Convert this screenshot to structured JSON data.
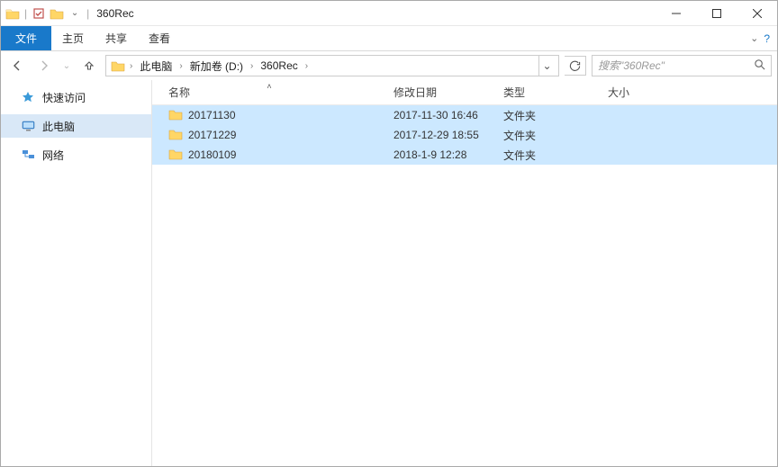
{
  "titlebar": {
    "title": "360Rec"
  },
  "ribbon": {
    "file": "文件",
    "home": "主页",
    "share": "共享",
    "view": "查看"
  },
  "breadcrumb": {
    "items": [
      {
        "label": "此电脑"
      },
      {
        "label": "新加卷 (D:)"
      },
      {
        "label": "360Rec"
      }
    ]
  },
  "search": {
    "placeholder": "搜索\"360Rec\""
  },
  "sidebar": {
    "quick": "快速访问",
    "thispc": "此电脑",
    "network": "网络"
  },
  "columns": {
    "name": "名称",
    "date": "修改日期",
    "type": "类型",
    "size": "大小"
  },
  "rows": [
    {
      "name": "20171130",
      "date": "2017-11-30 16:46",
      "type": "文件夹"
    },
    {
      "name": "20171229",
      "date": "2017-12-29 18:55",
      "type": "文件夹"
    },
    {
      "name": "20180109",
      "date": "2018-1-9 12:28",
      "type": "文件夹"
    }
  ]
}
